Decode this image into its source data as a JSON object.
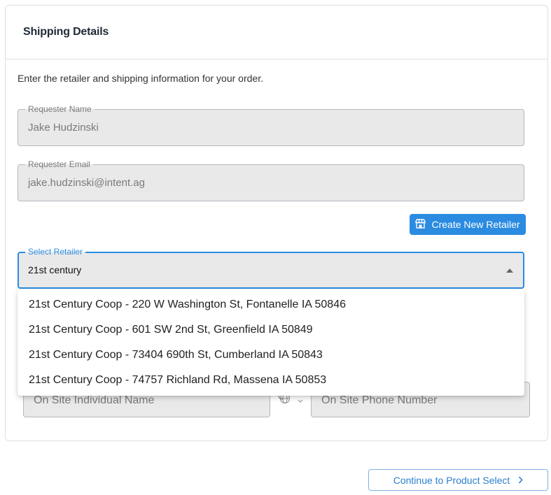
{
  "card": {
    "title": "Shipping Details",
    "intro": "Enter the retailer and shipping information for your order."
  },
  "requester_name": {
    "label": "Requester Name",
    "value": "Jake Hudzinski"
  },
  "requester_email": {
    "label": "Requester Email",
    "value": "jake.hudzinski@intent.ag"
  },
  "create_retailer": {
    "label": "Create New Retailer",
    "icon": "store-icon"
  },
  "select_retailer": {
    "label": "Select Retailer",
    "value": "21st century",
    "options": [
      "21st Century Coop - 220 W Washington St, Fontanelle IA 50846",
      "21st Century Coop - 601 SW 2nd St, Greenfield IA 50849",
      "21st Century Coop - 73404 690th St, Cumberland IA 50843",
      "21st Century Coop - 74757 Richland Rd, Massena IA 50853"
    ]
  },
  "on_site": {
    "name_placeholder": "On Site Individual Name",
    "phone_placeholder": "On Site Phone Number"
  },
  "continue": {
    "label": "Continue to Product Select",
    "icon": "chevron-right-icon"
  },
  "colors": {
    "accent": "#2a8be0",
    "field_bg": "#e9e9ea",
    "border": "#dcdfe4"
  }
}
